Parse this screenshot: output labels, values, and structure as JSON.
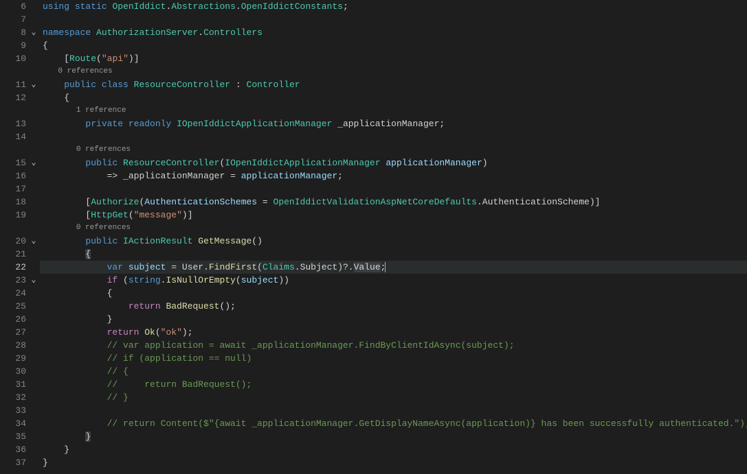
{
  "gutter": {
    "lines": [
      {
        "n": "6",
        "fold": ""
      },
      {
        "n": "7",
        "fold": ""
      },
      {
        "n": "8",
        "fold": "v"
      },
      {
        "n": "9",
        "fold": ""
      },
      {
        "n": "10",
        "fold": ""
      },
      {
        "cl": "0 references",
        "indent": "            "
      },
      {
        "n": "11",
        "fold": "v"
      },
      {
        "n": "12",
        "fold": ""
      },
      {
        "cl": "1 reference",
        "indent": "                "
      },
      {
        "n": "13",
        "fold": ""
      },
      {
        "n": "14",
        "fold": ""
      },
      {
        "cl": "0 references",
        "indent": "                "
      },
      {
        "n": "15",
        "fold": "v"
      },
      {
        "n": "16",
        "fold": ""
      },
      {
        "n": "17",
        "fold": ""
      },
      {
        "n": "18",
        "fold": ""
      },
      {
        "n": "19",
        "fold": ""
      },
      {
        "cl": "0 references",
        "indent": "                "
      },
      {
        "n": "20",
        "fold": "v"
      },
      {
        "n": "21",
        "fold": ""
      },
      {
        "n": "22",
        "fold": "",
        "current": true
      },
      {
        "n": "23",
        "fold": "v"
      },
      {
        "n": "24",
        "fold": ""
      },
      {
        "n": "25",
        "fold": ""
      },
      {
        "n": "26",
        "fold": ""
      },
      {
        "n": "27",
        "fold": ""
      },
      {
        "n": "28",
        "fold": ""
      },
      {
        "n": "29",
        "fold": ""
      },
      {
        "n": "30",
        "fold": ""
      },
      {
        "n": "31",
        "fold": ""
      },
      {
        "n": "32",
        "fold": ""
      },
      {
        "n": "33",
        "fold": ""
      },
      {
        "n": "34",
        "fold": ""
      },
      {
        "n": "35",
        "fold": ""
      },
      {
        "n": "36",
        "fold": ""
      },
      {
        "n": "37",
        "fold": ""
      }
    ]
  },
  "tokens": {
    "l6": {
      "t1": "using",
      "t2": "static",
      "t3": "OpenIddict",
      "t4": "Abstractions",
      "t5": "OpenIddictConstants"
    },
    "l8": {
      "t1": "namespace",
      "t2": "AuthorizationServer",
      "t3": "Controllers"
    },
    "l10": {
      "t1": "Route",
      "t2": "\"api\""
    },
    "l11": {
      "t1": "public",
      "t2": "class",
      "t3": "ResourceController",
      "t4": "Controller"
    },
    "l13": {
      "t1": "private",
      "t2": "readonly",
      "t3": "IOpenIddictApplicationManager",
      "t4": "_applicationManager"
    },
    "l15": {
      "t1": "public",
      "t2": "ResourceController",
      "t3": "IOpenIddictApplicationManager",
      "t4": "applicationManager"
    },
    "l16": {
      "t1": "_applicationManager",
      "t2": "applicationManager"
    },
    "l18": {
      "t1": "Authorize",
      "t2": "AuthenticationSchemes",
      "t3": "OpenIddictValidationAspNetCoreDefaults",
      "t4": "AuthenticationScheme"
    },
    "l19": {
      "t1": "HttpGet",
      "t2": "\"message\""
    },
    "l20": {
      "t1": "public",
      "t2": "IActionResult",
      "t3": "GetMessage"
    },
    "l22": {
      "t1": "var",
      "t2": "subject",
      "t3": "User",
      "t4": "FindFirst",
      "t5": "Claims",
      "t6": "Subject",
      "t7": "Value"
    },
    "l23": {
      "t1": "if",
      "t2": "string",
      "t3": "IsNullOrEmpty",
      "t4": "subject"
    },
    "l25": {
      "t1": "return",
      "t2": "BadRequest"
    },
    "l27": {
      "t1": "return",
      "t2": "Ok",
      "t3": "\"ok\""
    },
    "l28": {
      "t1": "// var application = await _applicationManager.FindByClientIdAsync(subject);"
    },
    "l29": {
      "t1": "// if (application == null)"
    },
    "l30": {
      "t1": "// {"
    },
    "l31": {
      "t1": "//     return BadRequest();"
    },
    "l32": {
      "t1": "// }"
    },
    "l34": {
      "t1": "// return Content($\"{await _applicationManager.GetDisplayNameAsync(application)} has been successfully authenticated.\");"
    }
  },
  "punct": {
    "dot": ".",
    "semi": ";",
    "lbrace": "{",
    "rbrace": "}",
    "lbrack": "[",
    "rbrack": "]",
    "lparen": "(",
    "rparen": ")",
    "colon": ":",
    "eq": "=",
    "arrow": "=>",
    "qdot": "?.",
    "comma": ","
  }
}
